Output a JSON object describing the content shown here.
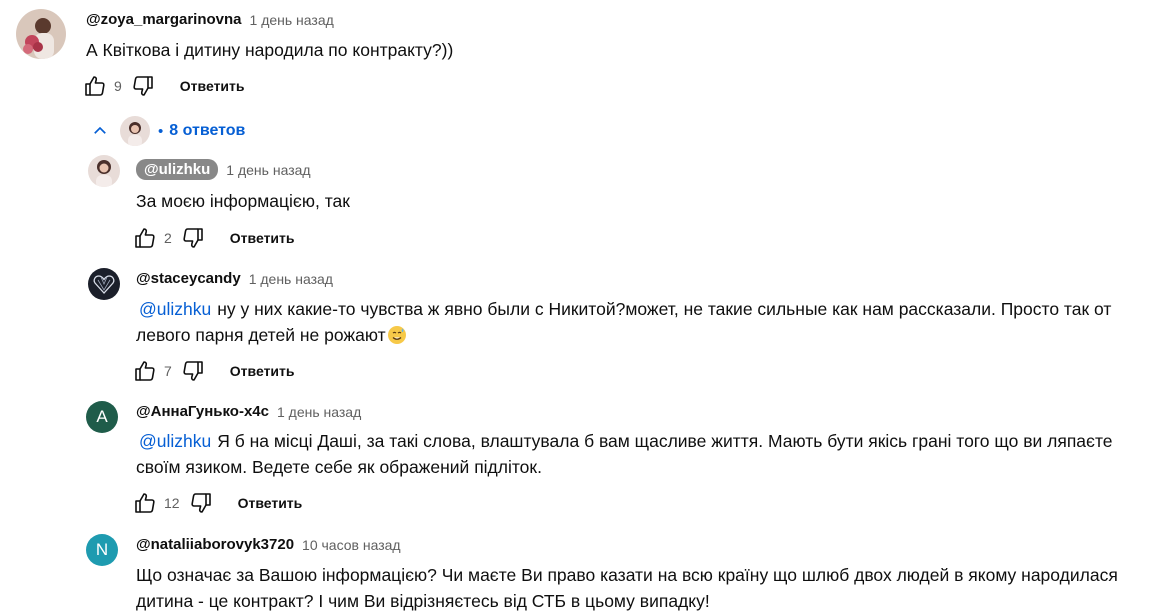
{
  "comment": {
    "author": "@zoya_margarinovna",
    "time": "1 день назад",
    "text": "А Квіткова і дитину народила по контракту?))",
    "likes": "9",
    "reply_label": "Ответить"
  },
  "replies_toggle": {
    "count_label": "8 ответов"
  },
  "replies": [
    {
      "author": "@ulizhku",
      "time": "1 день назад",
      "text": "За моєю інформацією, так",
      "likes": "2",
      "reply_label": "Ответить"
    },
    {
      "author": "@staceycandy",
      "time": "1 день назад",
      "mention": "@ulizhku",
      "text_line1": "ну у них какие-то чувства ж явно были с Никитой?может, не такие сильные как нам рассказали. Просто так от",
      "text_line2": "левого парня детей не рожают",
      "likes": "7",
      "reply_label": "Ответить"
    },
    {
      "author": "@АннаГунько-х4с",
      "time": "1 день назад",
      "avatar_letter": "А",
      "mention": "@ulizhku",
      "text_line1": "Я б на місці Даші, за такі слова,  влаштувала б вам щасливе життя. Мають бути якісь грані того що ви ляпаєте",
      "text_line2": "своїм язиком. Ведете себе як ображений підліток.",
      "likes": "12",
      "reply_label": "Ответить"
    },
    {
      "author": "@nataliiaborovyk3720",
      "time": "10 часов назад",
      "avatar_letter": "N",
      "text_line1": "Що означає за Вашою інформацією? Чи маєте Ви право казати на всю країну що шлюб двох людей в якому народилася",
      "text_line2": "дитина - це контракт? І чим Ви відрізняєтесь від СТБ в цьому випадку!"
    }
  ],
  "colors": {
    "link": "#065fd4",
    "secondary_text": "#606060",
    "author_chip_bg": "#888888",
    "avatar_anna": "#1f5c4a",
    "avatar_n": "#1e9bb0"
  },
  "icons": [
    "like-icon",
    "dislike-icon",
    "chevron-up-icon",
    "emoji-sweat-smile-icon"
  ]
}
